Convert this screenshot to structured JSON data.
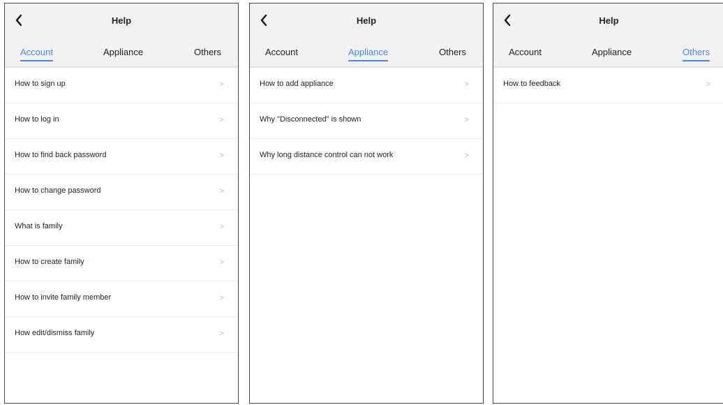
{
  "accent_color": "#4a86e8",
  "screens": [
    {
      "title": "Help",
      "back_icon": "chevron-left-icon",
      "tabs": [
        "Account",
        "Appliance",
        "Others"
      ],
      "active_tab": 0,
      "chevron_glyph": ">",
      "items": [
        "How to sign up",
        "How to log in",
        "How to find back password",
        "How to change password",
        "What is family",
        "How to create family",
        "How to invite family member",
        "How edit/dismiss family"
      ]
    },
    {
      "title": "Help",
      "back_icon": "chevron-left-icon",
      "tabs": [
        "Account",
        "Appliance",
        "Others"
      ],
      "active_tab": 1,
      "chevron_glyph": ">",
      "items": [
        "How to add appliance",
        "Why \"Disconnected\" is shown",
        "Why long distance control can not work"
      ]
    },
    {
      "title": "Help",
      "back_icon": "chevron-left-icon",
      "tabs": [
        "Account",
        "Appliance",
        "Others"
      ],
      "active_tab": 2,
      "chevron_glyph": ">",
      "items": [
        "How to feedback"
      ]
    }
  ]
}
